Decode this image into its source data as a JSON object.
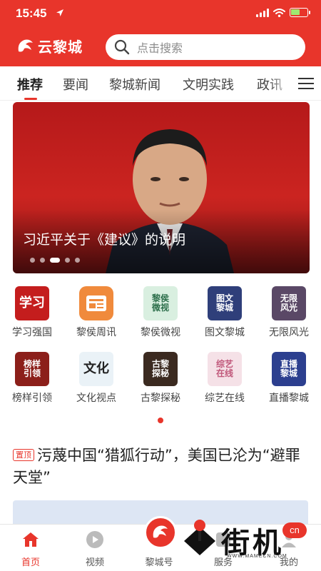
{
  "status": {
    "time": "15:45",
    "battery_level": 0.55
  },
  "header": {
    "app_name": "云黎城",
    "search_placeholder": "点击搜索",
    "brand_color": "#e8352b"
  },
  "tabs": [
    {
      "label": "推荐",
      "active": true
    },
    {
      "label": "要闻"
    },
    {
      "label": "黎城新闻"
    },
    {
      "label": "文明实践"
    },
    {
      "label": "政讯"
    }
  ],
  "banner": {
    "caption": "习近平关于《建议》的说明",
    "slides": 5,
    "active_slide": 3
  },
  "grid": [
    {
      "label": "学习强国",
      "icon_text": "学习",
      "color": "#c41d1d"
    },
    {
      "label": "黎侯周讯",
      "icon_text": "",
      "color": "#f08a3c"
    },
    {
      "label": "黎侯微视",
      "icon_text": "黎侯微视",
      "color": "#d9efe0"
    },
    {
      "label": "图文黎城",
      "icon_text": "图文黎城",
      "color": "#2f3f7a"
    },
    {
      "label": "无限风光",
      "icon_text": "无限风光",
      "color": "#5a4866"
    },
    {
      "label": "榜样引领",
      "icon_text": "榜样引领",
      "color": "#8c1f1a"
    },
    {
      "label": "文化视点",
      "icon_text": "文化",
      "color": "#eaf2f7"
    },
    {
      "label": "古黎探秘",
      "icon_text": "古黎探秘",
      "color": "#3b2a20"
    },
    {
      "label": "综艺在线",
      "icon_text": "综艺在线",
      "color": "#f5e1e7"
    },
    {
      "label": "直播黎城",
      "icon_text": "直播黎城",
      "color": "#2c3f8f"
    }
  ],
  "article": {
    "badge": "置顶",
    "title": "污蔑中国“猎狐行动”，美国已沦为“避罪天堂”"
  },
  "tabbar": [
    {
      "label": "首页",
      "active": true
    },
    {
      "label": "视频"
    },
    {
      "label": "黎城号"
    },
    {
      "label": "服务"
    },
    {
      "label": "我的"
    }
  ],
  "watermark": {
    "text": "街机",
    "badge": "cn",
    "url": "WWW.MAMECN.COM"
  }
}
